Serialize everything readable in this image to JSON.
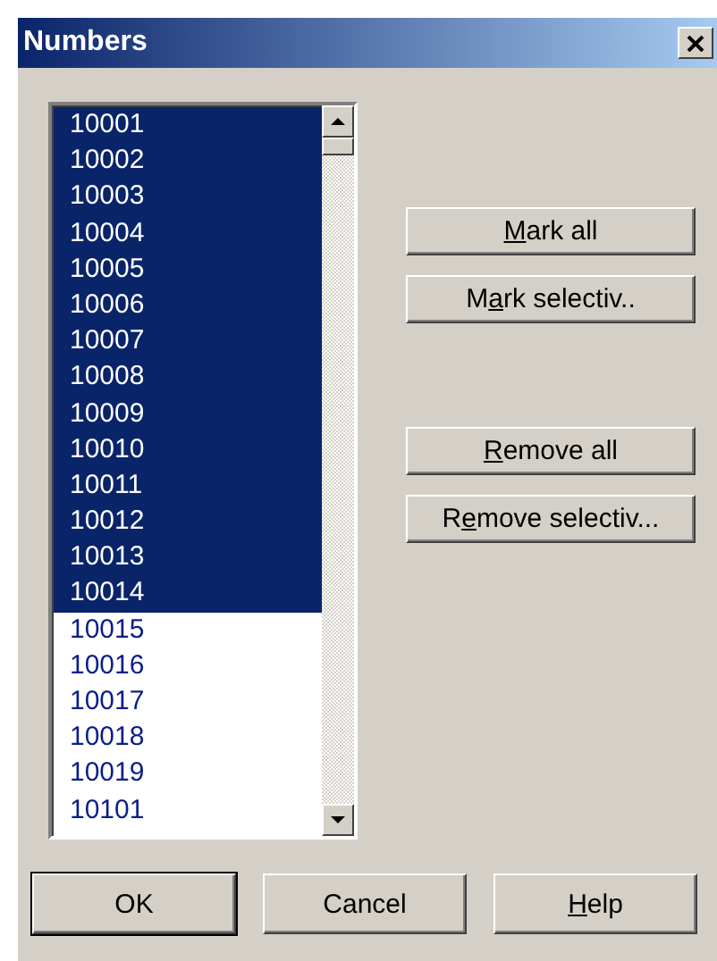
{
  "window": {
    "title": "Numbers"
  },
  "list": {
    "items": [
      {
        "text": "10001",
        "selected": true
      },
      {
        "text": "10002",
        "selected": true
      },
      {
        "text": "10003",
        "selected": true
      },
      {
        "text": "10004",
        "selected": true
      },
      {
        "text": "10005",
        "selected": true
      },
      {
        "text": "10006",
        "selected": true
      },
      {
        "text": "10007",
        "selected": true
      },
      {
        "text": "10008",
        "selected": true
      },
      {
        "text": "10009",
        "selected": true
      },
      {
        "text": "10010",
        "selected": true
      },
      {
        "text": "10011",
        "selected": true
      },
      {
        "text": "10012",
        "selected": true
      },
      {
        "text": "10013",
        "selected": true
      },
      {
        "text": "10014",
        "selected": true
      },
      {
        "text": "10015",
        "selected": false
      },
      {
        "text": "10016",
        "selected": false
      },
      {
        "text": "10017",
        "selected": false
      },
      {
        "text": "10018",
        "selected": false
      },
      {
        "text": "10019",
        "selected": false
      },
      {
        "text": "10101",
        "selected": false
      }
    ]
  },
  "side_buttons": [
    {
      "parts": [
        {
          "text": "M",
          "underlined": true
        },
        {
          "text": "ark all",
          "underlined": false
        }
      ]
    },
    {
      "parts": [
        {
          "text": "M",
          "underlined": false
        },
        {
          "text": "a",
          "underlined": true
        },
        {
          "text": "rk selectiv..",
          "underlined": false
        }
      ]
    },
    {
      "parts": [
        {
          "text": "R",
          "underlined": true
        },
        {
          "text": "emove all",
          "underlined": false
        }
      ]
    },
    {
      "parts": [
        {
          "text": "R",
          "underlined": false
        },
        {
          "text": "e",
          "underlined": true
        },
        {
          "text": "move selectiv...",
          "underlined": false
        }
      ]
    }
  ],
  "bottom_buttons": [
    {
      "parts": [
        {
          "text": "OK",
          "underlined": false
        }
      ],
      "default": true
    },
    {
      "parts": [
        {
          "text": "Cancel",
          "underlined": false
        }
      ],
      "default": false
    },
    {
      "parts": [
        {
          "text": "H",
          "underlined": true
        },
        {
          "text": "elp",
          "underlined": false
        }
      ],
      "default": false
    }
  ]
}
